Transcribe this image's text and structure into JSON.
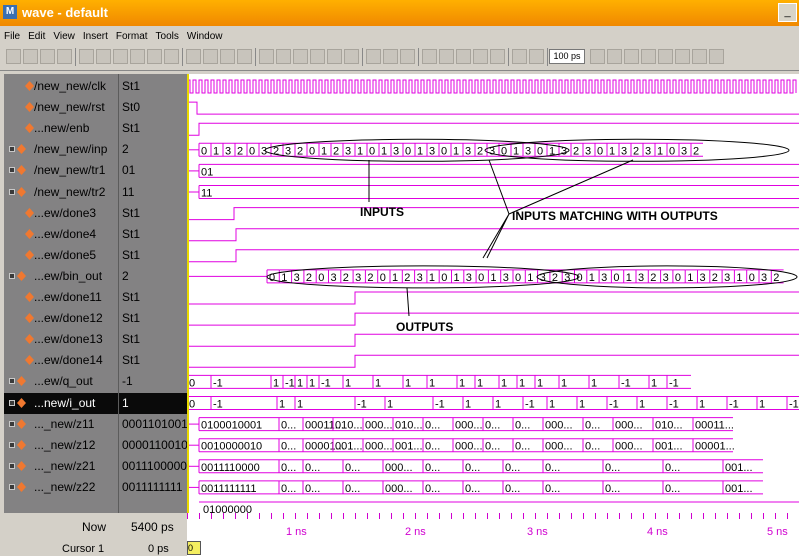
{
  "window": {
    "title": "wave - default"
  },
  "menu": [
    "File",
    "Edit",
    "View",
    "Insert",
    "Format",
    "Tools",
    "Window"
  ],
  "toolbar": {
    "icons": [
      "new-icon",
      "open-icon",
      "save-icon",
      "print-icon",
      "cut-icon",
      "copy-icon",
      "paste-icon",
      "undo-icon",
      "redo-icon",
      "find-icon",
      "sort-icon",
      "hierarchy-icon",
      "dataflow-icon",
      "list-icon",
      "add-wave-icon",
      "memory-icon",
      "source-icon",
      "cursor-add-icon",
      "cursor-delete-icon",
      "insert-divider-icon",
      "select-mode-icon",
      "zoom-mode-icon",
      "edit-mode-icon",
      "zoom-in-icon",
      "zoom-out-icon",
      "zoom-full-icon",
      "find-edge-icon",
      "compare-icon",
      "step-icon",
      "run-icon",
      "run-length-icon",
      "continue-icon",
      "break-icon",
      "restart-icon",
      "step-over-icon",
      "step-out-icon",
      "bookmark-icon",
      "bookmark-add-icon"
    ],
    "run_length": "100 ps"
  },
  "signals": [
    {
      "name": "/new_new/clk",
      "value": "St1",
      "type": "bit"
    },
    {
      "name": "/new_new/rst",
      "value": "St0",
      "type": "bit"
    },
    {
      "name": "...new/enb",
      "value": "St1",
      "type": "bit"
    },
    {
      "name": "/new_new/inp",
      "value": "2",
      "type": "bus"
    },
    {
      "name": "/new_new/tr1",
      "value": "01",
      "type": "bus"
    },
    {
      "name": "/new_new/tr2",
      "value": "11",
      "type": "bus"
    },
    {
      "name": "...ew/done3",
      "value": "St1",
      "type": "bit"
    },
    {
      "name": "...ew/done4",
      "value": "St1",
      "type": "bit"
    },
    {
      "name": "...ew/done5",
      "value": "St1",
      "type": "bit"
    },
    {
      "name": "...ew/bin_out",
      "value": "2",
      "type": "bus"
    },
    {
      "name": "...ew/done11",
      "value": "St1",
      "type": "bit"
    },
    {
      "name": "...ew/done12",
      "value": "St1",
      "type": "bit"
    },
    {
      "name": "...ew/done13",
      "value": "St1",
      "type": "bit"
    },
    {
      "name": "...ew/done14",
      "value": "St1",
      "type": "bit"
    },
    {
      "name": "...ew/q_out",
      "value": "-1",
      "type": "bus"
    },
    {
      "name": "...new/i_out",
      "value": "1",
      "type": "bus",
      "selected": true
    },
    {
      "name": "..._new/z11",
      "value": "0001101001",
      "type": "bus"
    },
    {
      "name": "..._new/z12",
      "value": "0000110010",
      "type": "bus"
    },
    {
      "name": "..._new/z21",
      "value": "0011100000",
      "type": "bus"
    },
    {
      "name": "..._new/z22",
      "value": "0011111111",
      "type": "bus"
    }
  ],
  "waves": {
    "inp": [
      "0",
      "1",
      "3",
      "2",
      "0",
      "3",
      "2",
      "3",
      "2",
      "0",
      "1",
      "2",
      "3",
      "1",
      "0",
      "1",
      "3",
      "0",
      "1",
      "3",
      "0",
      "1",
      "3",
      "2",
      "3",
      "0",
      "1",
      "3",
      "0",
      "1",
      "3",
      "2",
      "3",
      "0",
      "1",
      "3",
      "2",
      "3",
      "1",
      "0",
      "3",
      "2"
    ],
    "tr1": "01",
    "tr2": "11",
    "bin_out": [
      "0",
      "1",
      "3",
      "2",
      "0",
      "3",
      "2",
      "3",
      "2",
      "0",
      "1",
      "2",
      "3",
      "1",
      "0",
      "1",
      "3",
      "0",
      "1",
      "3",
      "0",
      "1",
      "3",
      "2",
      "3",
      "0",
      "1",
      "3",
      "0",
      "1",
      "3",
      "2",
      "3",
      "0",
      "1",
      "3",
      "2",
      "3",
      "1",
      "0",
      "3",
      "2"
    ],
    "q_out": [
      "0",
      "-1",
      "1",
      "-1",
      "1",
      "1",
      "-1",
      "1",
      "1",
      "1",
      "1",
      "1",
      "1",
      "1",
      "1",
      "1",
      "1",
      "1",
      "-1",
      "1",
      "-1"
    ],
    "i_out": [
      "0",
      "-1",
      "1",
      "1",
      "-1",
      "1",
      "-1",
      "1",
      "1",
      "-1",
      "1",
      "1",
      "-1",
      "1",
      "-1",
      "1",
      "-1",
      "1",
      "-1",
      "1"
    ],
    "z11": [
      "0100010001",
      "0...",
      "00011...",
      "010...",
      "000...",
      "010...",
      "0...",
      "000...",
      "0...",
      "0...",
      "000...",
      "0...",
      "000...",
      "010...",
      "00011..."
    ],
    "z12": [
      "0010000010",
      "0...",
      "00001...",
      "001...",
      "000...",
      "001...",
      "0...",
      "000...",
      "0...",
      "0...",
      "000...",
      "0...",
      "000...",
      "001...",
      "00001..."
    ],
    "z21": [
      "0011110000",
      "0...",
      "0...",
      "0...",
      "000...",
      "0...",
      "0...",
      "0...",
      "0...",
      "0...",
      "0...",
      "001..."
    ],
    "z22": [
      "0011111111",
      "0...",
      "0...",
      "0...",
      "000...",
      "0...",
      "0...",
      "0...",
      "0...",
      "0...",
      "0...",
      "001..."
    ],
    "last_row": "01000000"
  },
  "annotations": {
    "inputs": "INPUTS",
    "matching": "INPUTS MATCHING WITH OUTPUTS",
    "outputs": "OUTPUTS"
  },
  "timeline": {
    "now_label": "Now",
    "now_value": "5400 ps",
    "cursor_label": "Cursor 1",
    "cursor_value": "0 ps",
    "cursor_tag": "0 ps",
    "ticks": [
      "1 ns",
      "2 ns",
      "3 ns",
      "4 ns",
      "5 ns"
    ]
  },
  "colors": {
    "title_bar": "#f09000",
    "wave_bg": "#ffffff",
    "wave_line": "#e000e0",
    "signal_panel": "#838283",
    "cursor": "#e8d800",
    "annotation": "#000000"
  }
}
